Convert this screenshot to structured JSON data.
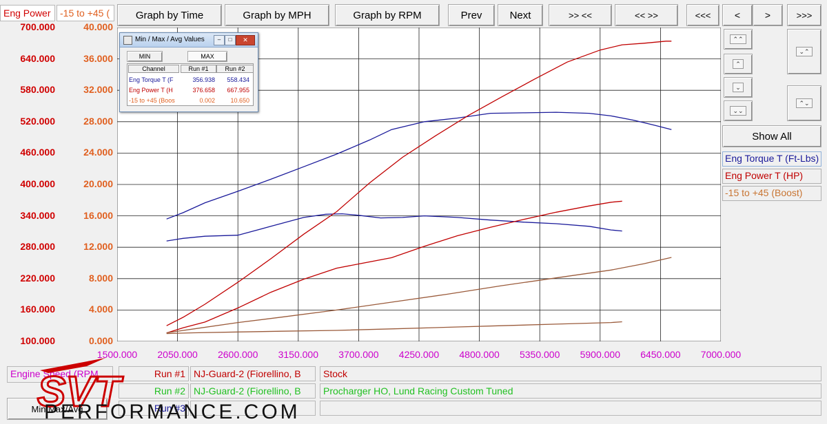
{
  "header": {
    "left_field": "Eng Power",
    "second_field": "-15 to +45 (",
    "buttons": [
      "Graph by Time",
      "Graph by MPH",
      "Graph by RPM",
      "Prev",
      "Next",
      ">> <<",
      "<< >>",
      "<<<",
      "<",
      ">",
      ">>>"
    ]
  },
  "right_panel": {
    "v_buttons": [
      "»",
      "«",
      "^",
      "v",
      "«",
      "»"
    ],
    "show_all": "Show All",
    "legend": [
      {
        "label": "Eng Torque T (Ft-Lbs)",
        "color": "#1a1a9a"
      },
      {
        "label": "Eng Power T (HP)",
        "color": "#c00000"
      },
      {
        "label": "-15 to +45 (Boost)",
        "color": "#c87533"
      }
    ]
  },
  "colors": {
    "torque": "#1a1a9a",
    "power": "#c00000",
    "boost": "#9a5a3a",
    "power_axis": "#d00000",
    "boost_axis": "#e06020",
    "rpm_axis": "#cc00cc"
  },
  "dialog": {
    "title": "Min / Max / Avg Values",
    "tabs": [
      "MIN",
      "MAX"
    ],
    "headers": [
      "Channel",
      "Run #1",
      "Run #2"
    ],
    "rows": [
      {
        "channel": "Eng Torque T (F",
        "run1": "356.938",
        "run2": "558.434",
        "color": "#1a1a9a"
      },
      {
        "channel": "Eng Power T (H",
        "run1": "376.658",
        "run2": "667.955",
        "color": "#c00000"
      },
      {
        "channel": "-15 to +45 (Boos",
        "run1": "0.002",
        "run2": "10.650",
        "color": "#e06020"
      }
    ]
  },
  "footer": {
    "x_channel": "Engine Speed (RPM",
    "runs": [
      {
        "label": "Run #1",
        "name": "NJ-Guard-2 (Fiorellino, B",
        "desc": "Stock",
        "color": "#c00000"
      },
      {
        "label": "Run #2",
        "name": "NJ-Guard-2 (Fiorellino, B",
        "desc": "Procharger HO, Lund Racing Custom Tuned",
        "color": "#22c022"
      },
      {
        "label": "Run #3",
        "color": "#1a1a9a"
      }
    ],
    "min_max_button": "Min/Max/Avg",
    "logo_letters": "SVT",
    "logo_text": "PERFORMANCE.COM"
  },
  "chart_data": {
    "type": "line",
    "x_axis": {
      "min": 1500,
      "max": 7000,
      "ticks": [
        "1500.000",
        "2050.000",
        "2600.000",
        "3150.000",
        "3700.000",
        "4250.000",
        "4800.000",
        "5350.000",
        "5900.000",
        "6450.000",
        "7000.000"
      ]
    },
    "y_left_power": {
      "min": 100,
      "max": 700,
      "ticks": [
        "700.000",
        "640.000",
        "580.000",
        "520.000",
        "460.000",
        "400.000",
        "340.000",
        "280.000",
        "220.000",
        "160.000",
        "100.000"
      ]
    },
    "y_left_boost": {
      "min": 0,
      "max": 40,
      "ticks": [
        "40.000",
        "36.000",
        "32.000",
        "28.000",
        "24.000",
        "20.000",
        "16.000",
        "12.000",
        "8.000",
        "4.000",
        "0.000"
      ]
    },
    "series": [
      {
        "name": "Eng Torque T (Ft-Lbs)",
        "run": "Run #2",
        "axis": "power",
        "color": "#1a1a9a",
        "x": [
          1950,
          2100,
          2300,
          2600,
          2900,
          3200,
          3500,
          3800,
          4000,
          4300,
          4600,
          4900,
          5200,
          5500,
          5800,
          6000,
          6200,
          6300,
          6400,
          6550
        ],
        "y": [
          334,
          346,
          365,
          387,
          410,
          434,
          458,
          485,
          505,
          520,
          527,
          536,
          537,
          538,
          536,
          531,
          523,
          518,
          513,
          505
        ]
      },
      {
        "name": "Eng Torque T (Ft-Lbs)",
        "run": "Run #1",
        "axis": "power",
        "color": "#1a1a9a",
        "x": [
          1950,
          2100,
          2300,
          2600,
          2900,
          3200,
          3400,
          3550,
          3700,
          3900,
          4100,
          4300,
          4600,
          4900,
          5200,
          5500,
          5800,
          6000,
          6100
        ],
        "y": [
          292,
          297,
          301,
          303,
          320,
          337,
          343,
          344,
          341,
          336,
          337,
          340,
          337,
          332,
          328,
          325,
          320,
          313,
          311
        ]
      },
      {
        "name": "Eng Power T (HP)",
        "run": "Run #2",
        "axis": "power",
        "color": "#c00000",
        "x": [
          1950,
          2100,
          2300,
          2600,
          2900,
          3200,
          3500,
          3800,
          4100,
          4400,
          4700,
          5000,
          5300,
          5600,
          5900,
          6100,
          6300,
          6500,
          6550
        ],
        "y": [
          130,
          146,
          171,
          213,
          258,
          305,
          348,
          403,
          452,
          493,
          532,
          567,
          601,
          634,
          657,
          667,
          670,
          674,
          674
        ]
      },
      {
        "name": "Eng Power T (HP)",
        "run": "Run #1",
        "axis": "power",
        "color": "#c00000",
        "x": [
          1950,
          2100,
          2300,
          2600,
          2900,
          3200,
          3500,
          3700,
          4000,
          4300,
          4600,
          4900,
          5200,
          5500,
          5800,
          6000,
          6100
        ],
        "y": [
          116,
          126,
          137,
          164,
          194,
          219,
          240,
          248,
          260,
          282,
          302,
          318,
          333,
          347,
          359,
          366,
          368
        ]
      },
      {
        "name": "-15 to +45 (Boost)",
        "run": "Run #2",
        "axis": "boost",
        "color": "#9a5a3a",
        "x": [
          1950,
          2200,
          2600,
          3000,
          3500,
          4000,
          4500,
          5000,
          5500,
          6000,
          6300,
          6550
        ],
        "y": [
          1.1,
          1.6,
          2.4,
          3.1,
          4.0,
          5.0,
          6.0,
          7.1,
          8.1,
          9.1,
          9.9,
          10.7
        ]
      },
      {
        "name": "-15 to +45 (Boost)",
        "run": "Run #1",
        "axis": "boost",
        "color": "#9a5a3a",
        "x": [
          1950,
          2200,
          2600,
          3000,
          3500,
          4000,
          4500,
          5000,
          5500,
          6000,
          6100
        ],
        "y": [
          1.0,
          1.1,
          1.2,
          1.3,
          1.4,
          1.6,
          1.8,
          2.0,
          2.2,
          2.4,
          2.5
        ]
      }
    ]
  }
}
